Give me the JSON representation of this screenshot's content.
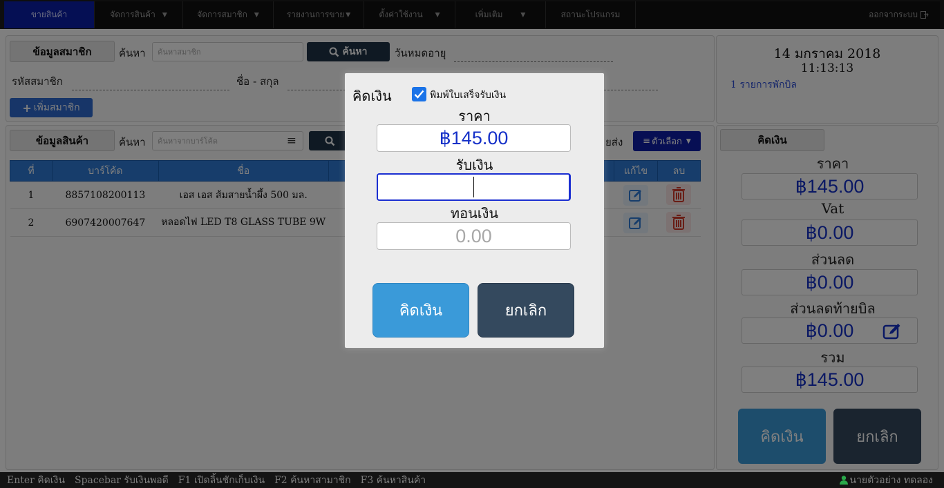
{
  "nav": {
    "items": [
      {
        "label": "ขายสินค้า",
        "dropdown": false
      },
      {
        "label": "จัดการสินค้า",
        "dropdown": true
      },
      {
        "label": "จัดการสมาชิก",
        "dropdown": true
      },
      {
        "label": "รายงานการขาย",
        "dropdown": true
      },
      {
        "label": "ตั้งค่าใช้งาน",
        "dropdown": true
      },
      {
        "label": "เพิ่มเติม",
        "dropdown": true
      },
      {
        "label": "สถานะโปรแกรม",
        "dropdown": false
      }
    ],
    "logout": "ออกจากระบบ"
  },
  "member": {
    "section_label": "ข้อมูลสมาชิก",
    "search_label": "ค้นหา",
    "search_placeholder": "ค้นหาสมาชิก",
    "search_button": "ค้นหา",
    "expiry_label": "วันหมดอายุ",
    "code_label": "รหัสสมาชิก",
    "name_label": "ชื่อ - สกุล",
    "add_button": "เพิ่มสมาชิก"
  },
  "info": {
    "date": "14 มกราคม 2018",
    "time": "11:13:13",
    "held_bills": "1 รายการพักบิล"
  },
  "product": {
    "section_label": "ข้อมูลสินค้า",
    "search_label": "ค้นหา",
    "search_placeholder": "ค้นหาจากบาร์โค้ด",
    "partial_label": "ยส่ง",
    "options_button": "ตัวเลือก",
    "columns": [
      "ที่",
      "บาร์โค้ด",
      "ชื่อ",
      "แก้ไข",
      "ลบ"
    ],
    "rows": [
      {
        "no": "1",
        "barcode": "8857108200113",
        "name": "เอส เอส ส้มสายน้ำผึ้ง 500 มล."
      },
      {
        "no": "2",
        "barcode": "6907420007647",
        "name": "หลอดไฟ LED T8 GLASS TUBE 9W"
      }
    ]
  },
  "summary": {
    "header": "คิดเงิน",
    "price_label": "ราคา",
    "price": "฿145.00",
    "vat_label": "Vat",
    "vat": "฿0.00",
    "discount_label": "ส่วนลด",
    "discount": "฿0.00",
    "bill_discount_label": "ส่วนลดท้ายบิล",
    "bill_discount": "฿0.00",
    "total_label": "รวม",
    "total": "฿145.00",
    "pay_button": "คิดเงิน",
    "cancel_button": "ยกเลิก"
  },
  "modal": {
    "title": "คิดเงิน",
    "print_receipt_label": "พิมพ์ใบเสร็จรับเงิน",
    "print_receipt_checked": true,
    "price_label": "ราคา",
    "price": "฿145.00",
    "received_label": "รับเงิน",
    "received_value": "",
    "change_label": "ทอนเงิน",
    "change_placeholder": "0.00",
    "pay_button": "คิดเงิน",
    "cancel_button": "ยกเลิก"
  },
  "statusbar": {
    "shortcuts": [
      "Enter คิดเงิน",
      "Spacebar รับเงินพอดี",
      "F1 เปิดลิ้นชักเก็บเงิน",
      "F2 ค้นหาสามาชิก",
      "F3 ค้นหาสินค้า"
    ],
    "user": "นายตัวอย่าง ทดลอง"
  },
  "colors": {
    "accent": "#2e6bd1",
    "dark": "#1f3347",
    "price_text": "#1530c8",
    "modal_pay": "#3a9ad9",
    "modal_cancel": "#34495e"
  }
}
